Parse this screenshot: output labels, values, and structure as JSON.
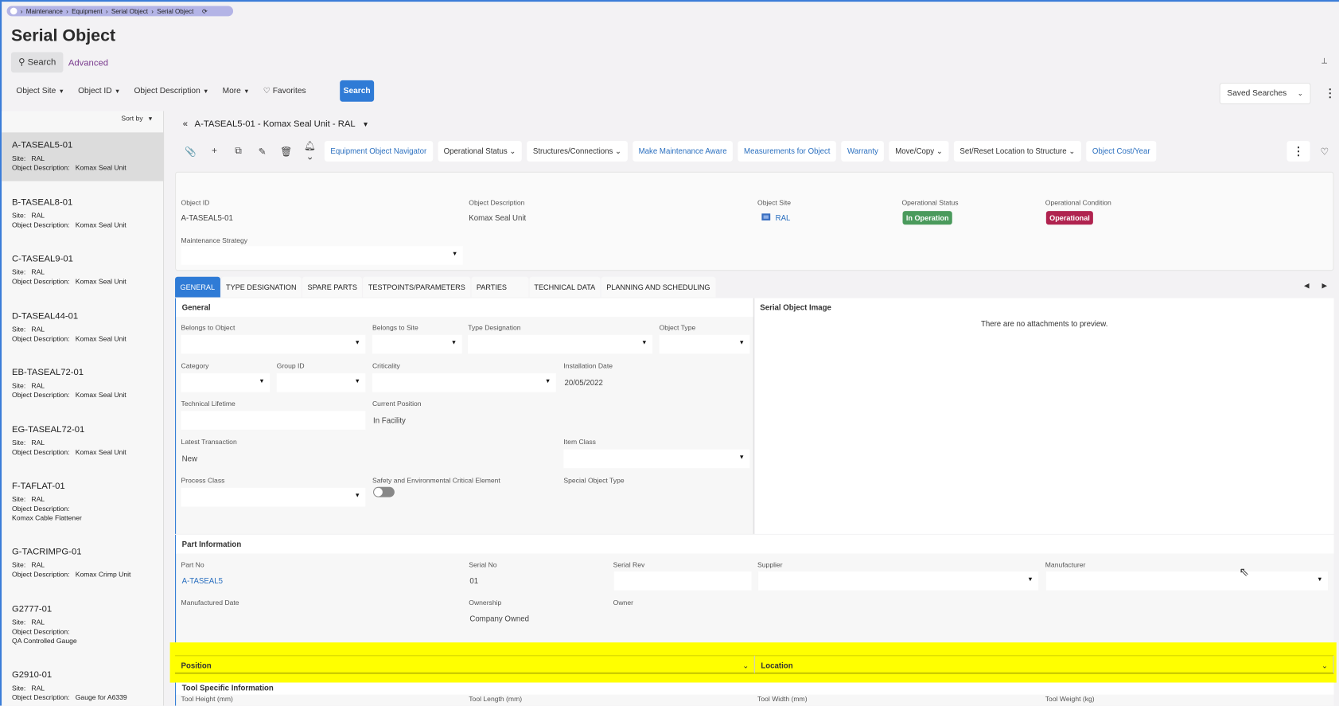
{
  "breadcrumb": [
    "Maintenance",
    "Equipment",
    "Serial Object",
    "Serial Object"
  ],
  "page_title": "Serial Object",
  "search": {
    "search_label": "Search",
    "advanced_label": "Advanced",
    "filters": [
      "Object Site",
      "Object ID",
      "Object Description",
      "More"
    ],
    "favorites": "Favorites",
    "search_button": "Search",
    "saved_searches": "Saved Searches"
  },
  "sidebar": {
    "sort_by": "Sort by",
    "site_label": "Site:",
    "desc_label": "Object Description:",
    "items": [
      {
        "id": "A-TASEAL5-01",
        "site": "RAL",
        "desc": "Komax Seal Unit"
      },
      {
        "id": "B-TASEAL8-01",
        "site": "RAL",
        "desc": "Komax Seal Unit"
      },
      {
        "id": "C-TASEAL9-01",
        "site": "RAL",
        "desc": "Komax Seal Unit"
      },
      {
        "id": "D-TASEAL44-01",
        "site": "RAL",
        "desc": "Komax Seal Unit"
      },
      {
        "id": "EB-TASEAL72-01",
        "site": "RAL",
        "desc": "Komax Seal Unit"
      },
      {
        "id": "EG-TASEAL72-01",
        "site": "RAL",
        "desc": "Komax Seal Unit"
      },
      {
        "id": "F-TAFLAT-01",
        "site": "RAL",
        "desc": "Komax Cable Flattener"
      },
      {
        "id": "G-TACRIMPG-01",
        "site": "RAL",
        "desc": "Komax Crimp Unit"
      },
      {
        "id": "G2777-01",
        "site": "RAL",
        "desc": "QA Controlled Gauge"
      },
      {
        "id": "G2910-01",
        "site": "RAL",
        "desc": "Gauge for A6339"
      }
    ]
  },
  "detail": {
    "title": "A-TASEAL5-01 - Komax Seal Unit - RAL",
    "toolbar": [
      "Equipment Object Navigator",
      "Operational Status",
      "Structures/Connections",
      "Make Maintenance Aware",
      "Measurements for Object",
      "Warranty",
      "Move/Copy",
      "Set/Reset Location to Structure",
      "Object Cost/Year"
    ]
  },
  "header": {
    "object_id_label": "Object ID",
    "object_id": "A-TASEAL5-01",
    "object_desc_label": "Object Description",
    "object_desc": "Komax Seal Unit",
    "object_site_label": "Object Site",
    "object_site": "RAL",
    "op_status_label": "Operational Status",
    "op_status": "In Operation",
    "op_condition_label": "Operational Condition",
    "op_condition": "Operational",
    "maint_strategy_label": "Maintenance Strategy",
    "colors": {
      "status": "#4a9a5c",
      "condition": "#b0234f"
    }
  },
  "tabs": [
    "GENERAL",
    "TYPE DESIGNATION",
    "SPARE PARTS",
    "TESTPOINTS/PARAMETERS",
    "PARTIES",
    "TECHNICAL DATA",
    "PLANNING AND SCHEDULING"
  ],
  "general": {
    "heading": "General",
    "belongs_to_object": "Belongs to Object",
    "belongs_to_site": "Belongs to Site",
    "type_designation": "Type Designation",
    "object_type": "Object Type",
    "category": "Category",
    "group_id": "Group ID",
    "criticality": "Criticality",
    "installation_date_label": "Installation Date",
    "installation_date": "20/05/2022",
    "technical_lifetime": "Technical Lifetime",
    "current_position_label": "Current Position",
    "current_position": "In Facility",
    "latest_transaction_label": "Latest Transaction",
    "latest_transaction": "New",
    "item_class": "Item Class",
    "process_class": "Process Class",
    "safety_label": "Safety and Environmental Critical Element",
    "special_object_type": "Special Object Type"
  },
  "image_panel": {
    "heading": "Serial Object Image",
    "empty": "There are no attachments to preview."
  },
  "part_info": {
    "heading": "Part Information",
    "part_no_label": "Part No",
    "part_no": "A-TASEAL5",
    "serial_no_label": "Serial No",
    "serial_no": "01",
    "serial_rev_label": "Serial Rev",
    "supplier_label": "Supplier",
    "manufacturer_label": "Manufacturer",
    "manufactured_date_label": "Manufactured Date",
    "ownership_label": "Ownership",
    "ownership": "Company Owned",
    "owner_label": "Owner"
  },
  "sections": {
    "position": "Position",
    "location": "Location",
    "tool_specific": "Tool Specific Information",
    "tool_height": "Tool Height (mm)",
    "tool_length": "Tool Length (mm)",
    "tool_width": "Tool Width (mm)",
    "tool_weight": "Tool Weight (kg)"
  }
}
